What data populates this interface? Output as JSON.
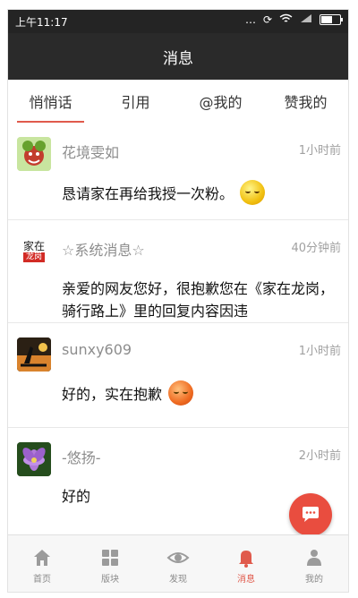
{
  "status": {
    "time": "上午11:17",
    "icons": [
      "dots-icon",
      "sync-icon",
      "wifi-icon",
      "signal-icon",
      "battery-icon"
    ]
  },
  "title": "消息",
  "tabs": [
    {
      "label": "悄悄话",
      "active": true
    },
    {
      "label": "引用",
      "active": false
    },
    {
      "label": "@我的",
      "active": false
    },
    {
      "label": "赞我的",
      "active": false
    }
  ],
  "messages": [
    {
      "name": "花境雯如",
      "time": "1小时前",
      "text": "恳请家在再给我授一次粉。",
      "emoji": "smile-emoji"
    },
    {
      "name": "☆系统消息☆",
      "time": "40分钟前",
      "text": "亲爱的网友您好，很抱歉您在《家在龙岗，骑行路上》里的回复内容因违",
      "avatar_text": "家在",
      "avatar_subtext": "龙岗"
    },
    {
      "name": "sunxy609",
      "time": "1小时前",
      "text": "好的，实在抱歉",
      "emoji": "apology-emoji"
    },
    {
      "name": "-悠扬-",
      "time": "2小时前",
      "text": "好的"
    }
  ],
  "fab_icon": "chat-icon",
  "bottom_nav": [
    {
      "label": "首页",
      "icon": "home-icon",
      "active": false
    },
    {
      "label": "版块",
      "icon": "grid-icon",
      "active": false
    },
    {
      "label": "发现",
      "icon": "eye-icon",
      "active": false
    },
    {
      "label": "消息",
      "icon": "bell-icon",
      "active": true
    },
    {
      "label": "我的",
      "icon": "person-icon",
      "active": false
    }
  ],
  "colors": {
    "header": "#242424",
    "accent": "#e05a4c",
    "fab": "#e94d3f"
  }
}
